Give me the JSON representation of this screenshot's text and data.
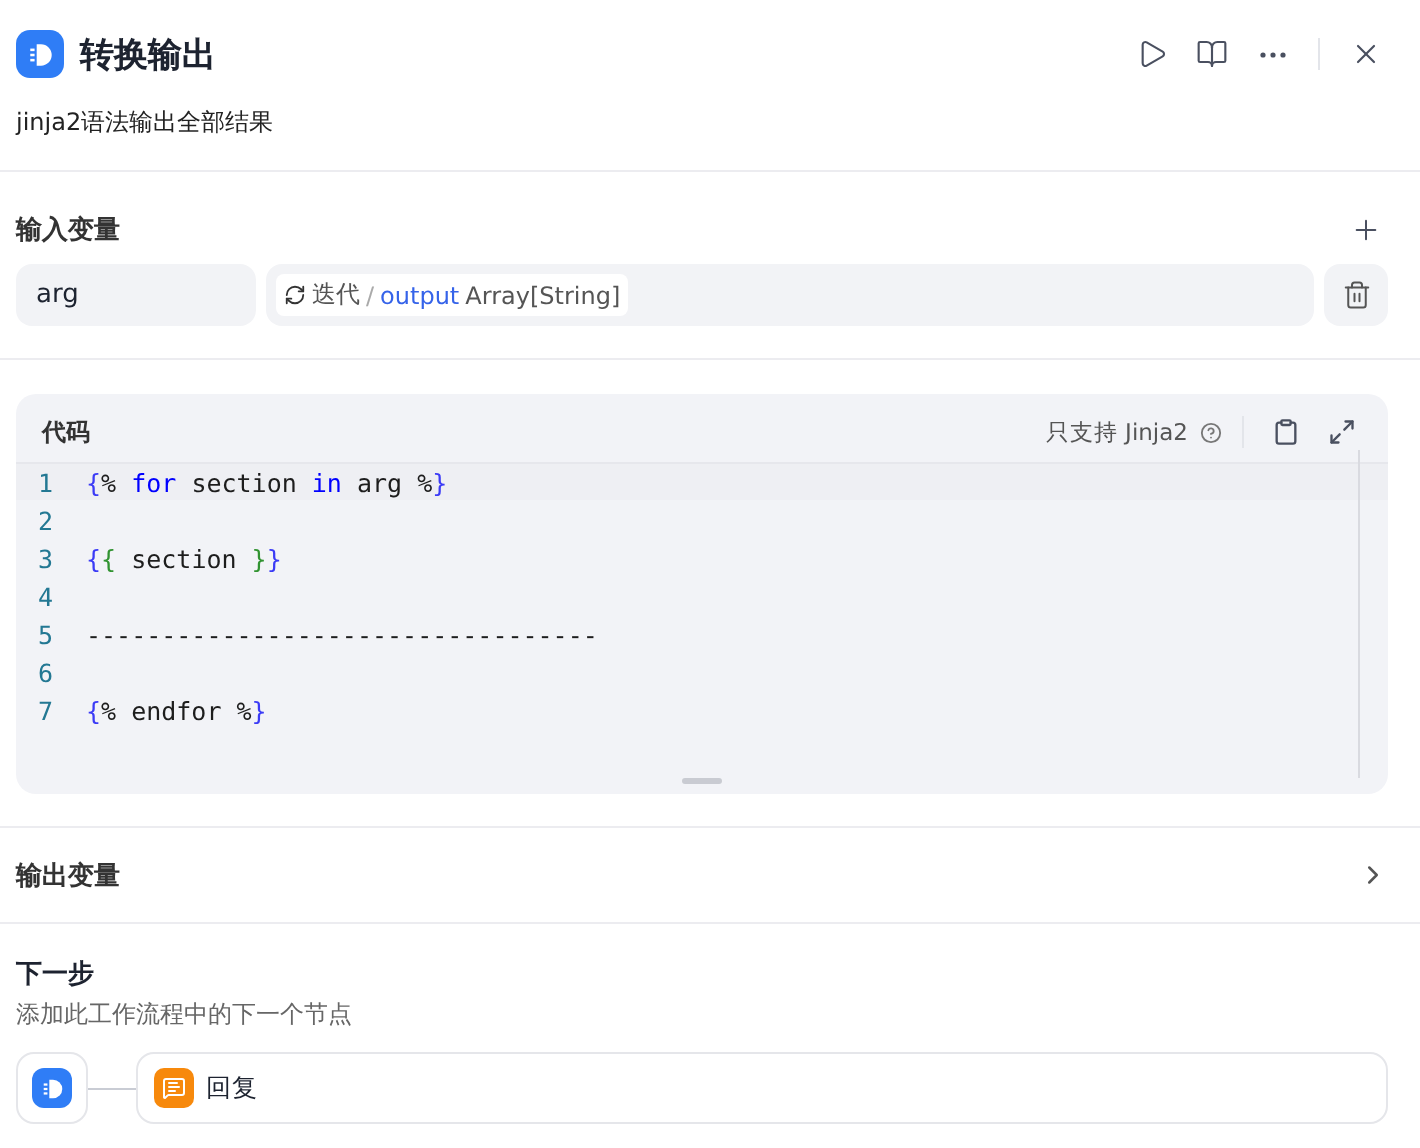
{
  "header": {
    "title": "转换输出",
    "description": "jinja2语法输出全部结果"
  },
  "input_vars": {
    "title": "输入变量",
    "items": [
      {
        "name": "arg",
        "source": "迭代",
        "separator": "/",
        "var": "output",
        "type": "Array[String]"
      }
    ]
  },
  "code": {
    "title": "代码",
    "support": "只支持 Jinja2",
    "lines": [
      {
        "number": "1",
        "tokens": [
          {
            "kind": "brace",
            "text": "{"
          },
          {
            "kind": "text",
            "text": "% "
          },
          {
            "kind": "keyword",
            "text": "for"
          },
          {
            "kind": "text",
            "text": " section "
          },
          {
            "kind": "keyword",
            "text": "in"
          },
          {
            "kind": "text",
            "text": " arg %"
          },
          {
            "kind": "brace",
            "text": "}"
          }
        ]
      },
      {
        "number": "2"
      },
      {
        "number": "3",
        "tokens": [
          {
            "kind": "brace",
            "text": "{"
          },
          {
            "kind": "brace2",
            "text": "{"
          },
          {
            "kind": "text",
            "text": " section "
          },
          {
            "kind": "brace2",
            "text": "}"
          },
          {
            "kind": "brace",
            "text": "}"
          }
        ]
      },
      {
        "number": "4"
      },
      {
        "number": "5",
        "tokens": [
          {
            "kind": "text",
            "text": "----------------------------------"
          }
        ]
      },
      {
        "number": "6"
      },
      {
        "number": "7",
        "tokens": [
          {
            "kind": "brace",
            "text": "{"
          },
          {
            "kind": "text",
            "text": "% endfor %"
          },
          {
            "kind": "brace",
            "text": "}"
          }
        ]
      }
    ]
  },
  "output_vars": {
    "title": "输出变量"
  },
  "next_step": {
    "title": "下一步",
    "description": "添加此工作流程中的下一个节点",
    "nodes": [
      {
        "label": "回复"
      }
    ]
  }
}
